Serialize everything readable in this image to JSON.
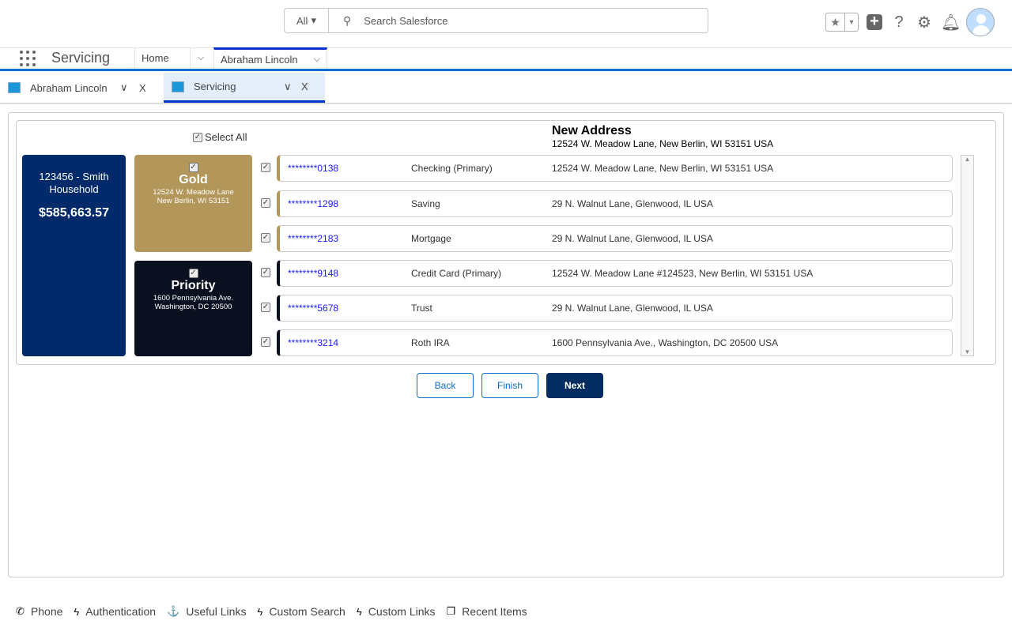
{
  "header": {
    "search_scope": "All",
    "search_placeholder": "Search Salesforce"
  },
  "nav": {
    "app_name": "Servicing",
    "tabs": [
      {
        "label": "Home"
      },
      {
        "label": "Abraham Lincoln"
      }
    ]
  },
  "subtabs": [
    {
      "label": "Abraham Lincoln",
      "close": "X"
    },
    {
      "label": "Servicing",
      "close": "X"
    }
  ],
  "panel": {
    "select_all": "Select All",
    "new_address_title": "New Address",
    "new_address": "12524 W. Meadow Lane, New Berlin, WI 53151 USA"
  },
  "household": {
    "name": "123456 - Smith Household",
    "total": "$585,663.57"
  },
  "tiers": [
    {
      "name": "Gold",
      "line1": "12524 W. Meadow Lane",
      "line2": "New Berlin, WI 53151",
      "color": "#b3975a"
    },
    {
      "name": "Priority",
      "line1": "1600 Pennsylvania Ave.",
      "line2": "Washington, DC 20500",
      "color": "#0b1020"
    }
  ],
  "accounts": [
    {
      "number": "********0138",
      "type": "Checking (Primary)",
      "address": "12524 W. Meadow Lane, New Berlin, WI 53151 USA"
    },
    {
      "number": "********1298",
      "type": "Saving",
      "address": "29 N. Walnut Lane, Glenwood, IL USA"
    },
    {
      "number": "********2183",
      "type": "Mortgage",
      "address": "29 N. Walnut Lane, Glenwood, IL USA"
    },
    {
      "number": "********9148",
      "type": "Credit Card (Primary)",
      "address": "12524 W. Meadow Lane #124523, New Berlin, WI 53151 USA"
    },
    {
      "number": "********5678",
      "type": "Trust",
      "address": "29 N. Walnut Lane, Glenwood, IL USA"
    },
    {
      "number": "********3214",
      "type": "Roth IRA",
      "address": "1600 Pennsylvania Ave., Washington, DC 20500 USA"
    }
  ],
  "buttons": {
    "back": "Back",
    "finish": "Finish",
    "next": "Next"
  },
  "footer": [
    {
      "label": "Phone"
    },
    {
      "label": "Authentication"
    },
    {
      "label": "Useful Links"
    },
    {
      "label": "Custom Search"
    },
    {
      "label": "Custom Links"
    },
    {
      "label": "Recent Items"
    }
  ]
}
